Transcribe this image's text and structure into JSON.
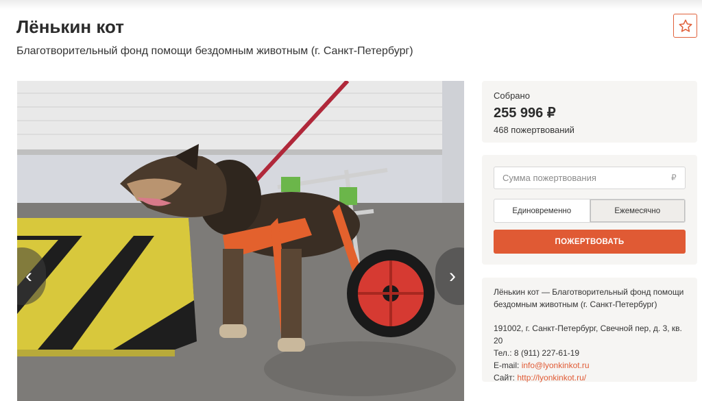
{
  "header": {
    "title": "Лёнькин кот",
    "subtitle": "Благотворительный фонд помощи бездомным животным (г. Санкт-Петербург)",
    "favorite_icon": "star-icon"
  },
  "gallery": {
    "image_alt": "dog-in-wheelchair-photo",
    "prev_label": "‹",
    "next_label": "›"
  },
  "stats": {
    "label": "Собрано",
    "amount": "255 996 ₽",
    "count": "468 пожертвований"
  },
  "donate_form": {
    "amount_placeholder": "Сумма пожертвования",
    "currency": "₽",
    "options": [
      "Единовременно",
      "Ежемесячно"
    ],
    "selected_option": "Ежемесячно",
    "submit_label": "ПОЖЕРТВОВАТЬ"
  },
  "org": {
    "description": "Лёнькин кот — Благотворительный фонд помощи бездомным животным (г. Санкт-Петербург)",
    "address": "191002, г. Санкт-Петербург, Свечной пер, д. 3, кв. 20",
    "phone": "Тел.: 8 (911) 227-61-19",
    "email_label": "E-mail:",
    "email": "info@lyonkinkot.ru",
    "site_label": "Сайт:",
    "site": "http://lyonkinkot.ru/"
  },
  "colors": {
    "accent": "#e05a34",
    "panel_bg": "#f6f5f3"
  }
}
